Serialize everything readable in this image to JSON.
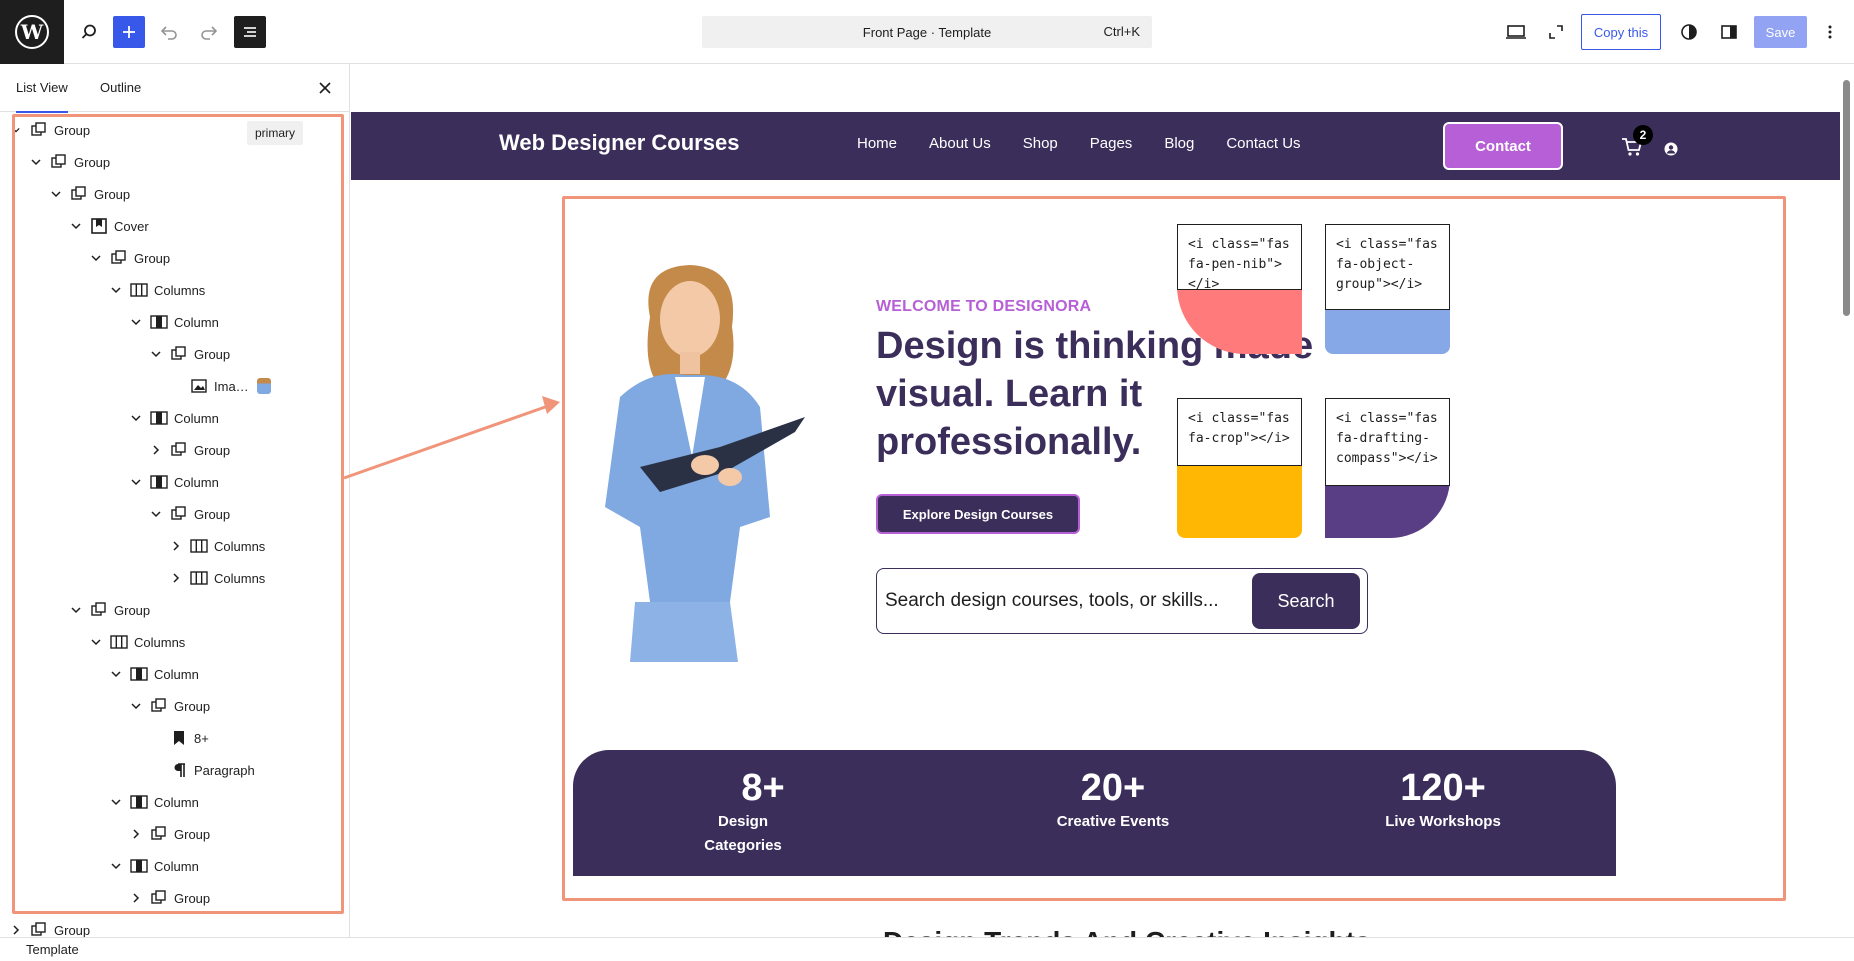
{
  "topbar": {
    "command_palette": {
      "label": "Front Page · Template",
      "shortcut": "Ctrl+K"
    },
    "copy_label": "Copy this",
    "save_label": "Save"
  },
  "sidebar": {
    "tabs": [
      "List View",
      "Outline"
    ],
    "badge": "primary",
    "tree": [
      {
        "label": "Group",
        "depth": 0,
        "state": "open-small",
        "icon": "group-icon"
      },
      {
        "label": "Group",
        "depth": 1,
        "state": "open",
        "icon": "group-icon"
      },
      {
        "label": "Group",
        "depth": 2,
        "state": "open",
        "icon": "group-icon"
      },
      {
        "label": "Cover",
        "depth": 3,
        "state": "open",
        "icon": "cover-icon"
      },
      {
        "label": "Group",
        "depth": 4,
        "state": "open",
        "icon": "group-icon"
      },
      {
        "label": "Columns",
        "depth": 5,
        "state": "open",
        "icon": "columns-icon"
      },
      {
        "label": "Column",
        "depth": 6,
        "state": "open",
        "icon": "column-icon"
      },
      {
        "label": "Group",
        "depth": 7,
        "state": "open",
        "icon": "group-icon"
      },
      {
        "label": "Ima…",
        "depth": 8,
        "state": "none",
        "icon": "image-icon"
      },
      {
        "label": "Column",
        "depth": 6,
        "state": "open",
        "icon": "column-icon"
      },
      {
        "label": "Group",
        "depth": 7,
        "state": "closed",
        "icon": "group-icon"
      },
      {
        "label": "Column",
        "depth": 6,
        "state": "open",
        "icon": "column-icon"
      },
      {
        "label": "Group",
        "depth": 7,
        "state": "open",
        "icon": "group-icon"
      },
      {
        "label": "Columns",
        "depth": 8,
        "state": "closed",
        "icon": "columns-icon"
      },
      {
        "label": "Columns",
        "depth": 8,
        "state": "closed",
        "icon": "columns-icon"
      },
      {
        "label": "Group",
        "depth": 3,
        "state": "open",
        "icon": "group-icon"
      },
      {
        "label": "Columns",
        "depth": 4,
        "state": "open",
        "icon": "columns-icon"
      },
      {
        "label": "Column",
        "depth": 5,
        "state": "open",
        "icon": "column-icon"
      },
      {
        "label": "Group",
        "depth": 6,
        "state": "open",
        "icon": "group-icon"
      },
      {
        "label": "8+",
        "depth": 7,
        "state": "none",
        "icon": "heading-icon"
      },
      {
        "label": "Paragraph",
        "depth": 7,
        "state": "none",
        "icon": "paragraph-icon"
      },
      {
        "label": "Column",
        "depth": 5,
        "state": "open",
        "icon": "column-icon"
      },
      {
        "label": "Group",
        "depth": 6,
        "state": "closed",
        "icon": "group-icon"
      },
      {
        "label": "Column",
        "depth": 5,
        "state": "open",
        "icon": "column-icon"
      },
      {
        "label": "Group",
        "depth": 6,
        "state": "closed",
        "icon": "group-icon"
      },
      {
        "label": "Group",
        "depth": 0,
        "state": "closed",
        "icon": "group-icon"
      }
    ]
  },
  "status_bar": {
    "label": "Template"
  },
  "site": {
    "title": "Web Designer Courses",
    "nav": [
      "Home",
      "About Us",
      "Shop",
      "Pages",
      "Blog",
      "Contact Us"
    ],
    "contact_label": "Contact",
    "cart_count": "2"
  },
  "hero": {
    "eyebrow": "WELCOME TO DESIGNORA",
    "headline": "Design is thinking made visual. Learn it professionally.",
    "cta": "Explore Design Courses",
    "search_placeholder": "Search design courses, tools, or skills...",
    "search_button": "Search",
    "tiles": [
      {
        "code": "<i class=\"fas fa-pen-nib\"></i>",
        "color": "#ff7b7b"
      },
      {
        "code": "<i class=\"fas fa-object-group\"></i>",
        "color": "#86a8e7"
      },
      {
        "code": "<i class=\"fas fa-crop\"></i>",
        "color": "#ffb703"
      },
      {
        "code": "<i class=\"fas fa-drafting-compass\"></i>",
        "color": "#5a3e85"
      }
    ]
  },
  "stats": [
    {
      "num": "8+",
      "cap": "Design Categories"
    },
    {
      "num": "20+",
      "cap": "Creative Events"
    },
    {
      "num": "120+",
      "cap": "Live Workshops"
    }
  ],
  "next_section_heading": "Design Trends And Creative Insights",
  "colors": {
    "accent": "#3858e9",
    "brand_dark": "#3b2e5a",
    "brand_purple": "#b65fd6",
    "highlight": "#f0947a"
  }
}
